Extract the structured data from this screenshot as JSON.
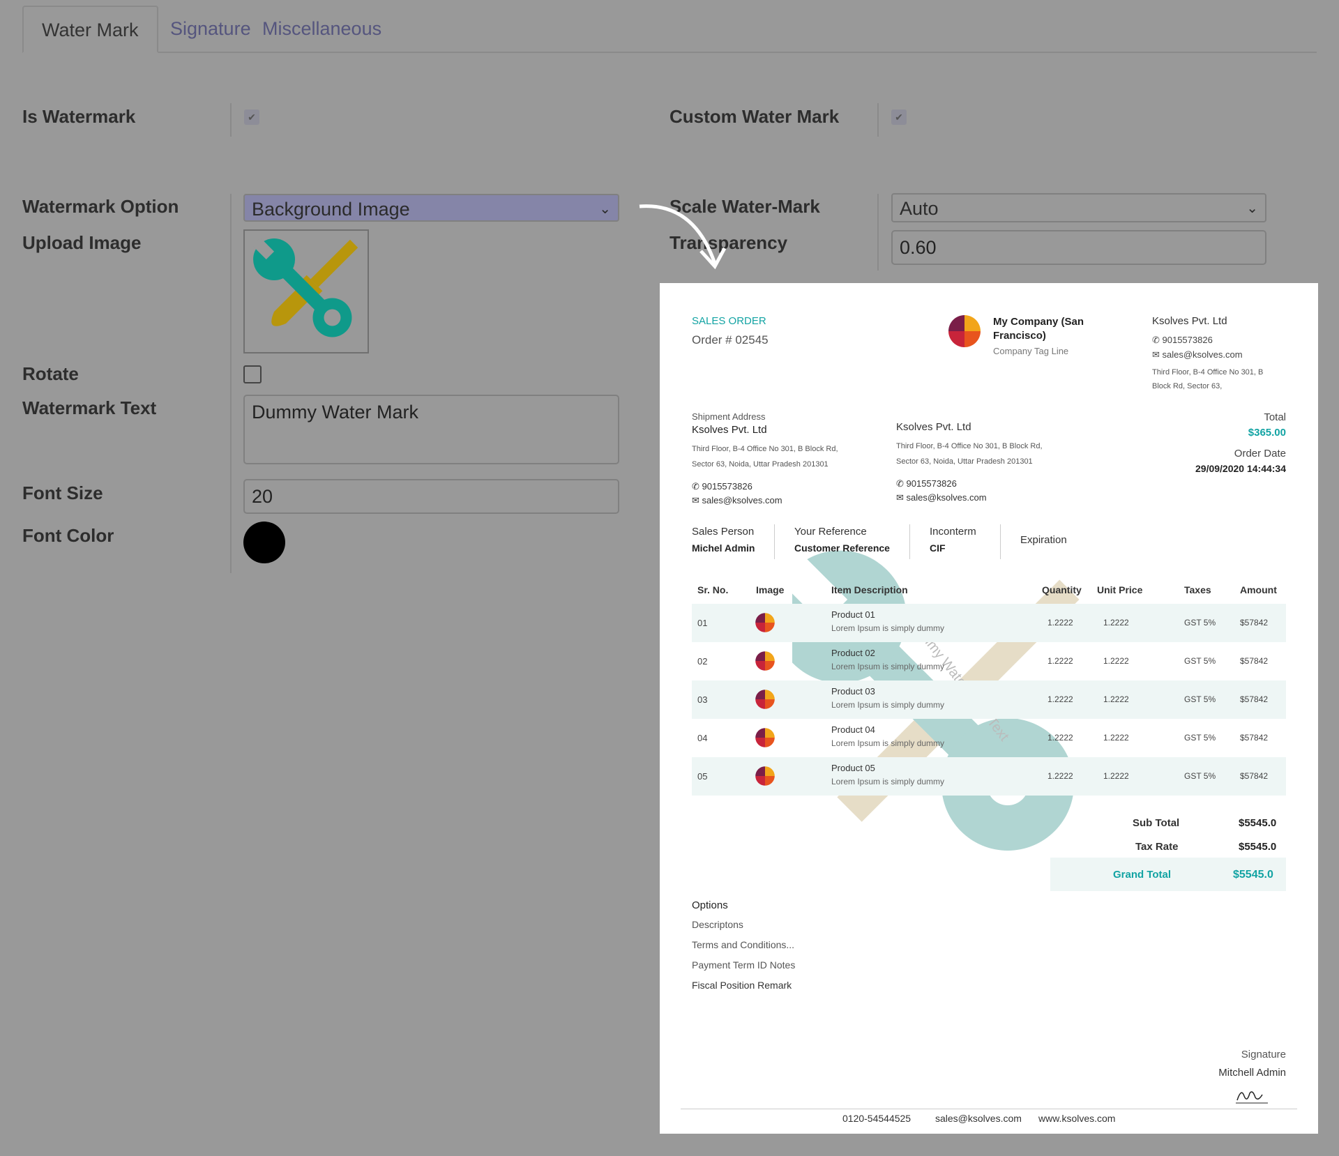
{
  "tabs": [
    {
      "label": "Water Mark",
      "active": true
    },
    {
      "label": "Signature",
      "active": false
    },
    {
      "label": "Miscellaneous",
      "active": false
    }
  ],
  "form": {
    "is_watermark_label": "Is Watermark",
    "custom_water_mark_label": "Custom Water Mark",
    "watermark_option_label": "Watermark Option",
    "watermark_option_value": "Background Image",
    "scale_label": "Scale Water-Mark",
    "scale_value": "Auto",
    "upload_image_label": "Upload Image",
    "transparency_label": "Transparency",
    "transparency_value": "0.60",
    "rotate_label": "Rotate",
    "watermark_text_label": "Watermark Text",
    "watermark_text_value": "Dummy Water Mark",
    "font_size_label": "Font Size",
    "font_size_value": "20",
    "font_color_label": "Font Color",
    "font_color": "#000000",
    "is_watermark_checked": true,
    "custom_water_mark_checked": true,
    "rotate_checked": false
  },
  "colors": {
    "background": "#999999",
    "select_highlight": "#8585a8",
    "teal": "#12a3a3",
    "wrench_teal": "#0f9a8a",
    "screwdriver_gold": "#b8960c"
  },
  "document": {
    "doc_type": "SALES ORDER",
    "order_number": "Order # 02545",
    "company_name": "My Company (San Francisco)",
    "company_tagline": "Company Tag Line",
    "vendor": {
      "name": "Ksolves Pvt. Ltd",
      "phone": "9015573826",
      "email": "sales@ksolves.com",
      "address_line1": "Third Floor, B-4 Office No 301, B",
      "address_line2": "Block Rd, Sector 63,"
    },
    "shipment": {
      "label": "Shipment Address",
      "name": "Ksolves Pvt. Ltd",
      "address_line1": "Third Floor, B-4 Office No 301, B Block Rd,",
      "address_line2": "Sector 63, Noida, Uttar Pradesh 201301",
      "phone": "9015573826",
      "email": "sales@ksolves.com"
    },
    "billing": {
      "name": "Ksolves Pvt. Ltd",
      "address_line1": "Third Floor, B-4 Office No 301, B Block Rd,",
      "address_line2": "Sector 63, Noida, Uttar Pradesh 201301",
      "phone": "9015573826",
      "email": "sales@ksolves.com"
    },
    "total_label": "Total",
    "total_value": "$365.00",
    "order_date_label": "Order Date",
    "order_date_value": "29/09/2020 14:44:34",
    "info": [
      {
        "label": "Sales Person",
        "value": "Michel Admin"
      },
      {
        "label": "Your Reference",
        "value": "Customer Reference"
      },
      {
        "label": "Inconterm",
        "value": "CIF"
      },
      {
        "label": "Expiration",
        "value": ""
      }
    ],
    "watermark_text": "Dummy Water Mark Text",
    "table_headers": [
      "Sr. No.",
      "Image",
      "Item Description",
      "Quantity",
      "Unit Price",
      "Taxes",
      "Amount"
    ],
    "rows": [
      {
        "sr": "01",
        "name": "Product 01",
        "desc": "Lorem Ipsum is simply dummy",
        "qty": "1.2222",
        "price": "1.2222",
        "tax": "GST 5%",
        "amount": "$57842"
      },
      {
        "sr": "02",
        "name": "Product 02",
        "desc": "Lorem Ipsum is simply dummy",
        "qty": "1.2222",
        "price": "1.2222",
        "tax": "GST 5%",
        "amount": "$57842"
      },
      {
        "sr": "03",
        "name": "Product 03",
        "desc": "Lorem Ipsum is simply dummy",
        "qty": "1.2222",
        "price": "1.2222",
        "tax": "GST 5%",
        "amount": "$57842"
      },
      {
        "sr": "04",
        "name": "Product 04",
        "desc": "Lorem Ipsum is simply dummy",
        "qty": "1.2222",
        "price": "1.2222",
        "tax": "GST 5%",
        "amount": "$57842"
      },
      {
        "sr": "05",
        "name": "Product 05",
        "desc": "Lorem Ipsum is simply dummy",
        "qty": "1.2222",
        "price": "1.2222",
        "tax": "GST 5%",
        "amount": "$57842"
      }
    ],
    "sub_total_label": "Sub Total",
    "sub_total_value": "$5545.0",
    "tax_rate_label": "Tax Rate",
    "tax_rate_value": "$5545.0",
    "grand_total_label": "Grand Total",
    "grand_total_value": "$5545.0",
    "options_title": "Options",
    "options": [
      "Descriptons",
      "Terms and Conditions...",
      "Payment Term ID Notes",
      "Fiscal Position Remark"
    ],
    "signature_label": "Signature",
    "signature_name": "Mitchell Admin",
    "footer_phone": "0120-54544525",
    "footer_email": "sales@ksolves.com",
    "footer_web": "www.ksolves.com"
  }
}
